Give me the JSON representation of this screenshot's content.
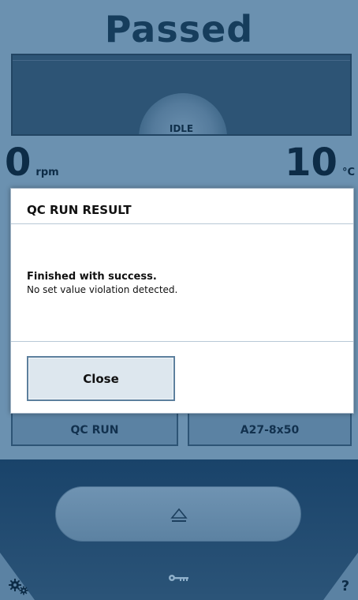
{
  "status": {
    "title": "Passed",
    "state_label": "IDLE"
  },
  "readouts": {
    "speed_value": "0",
    "speed_unit": "rpm",
    "temp_value": "10",
    "temp_unit": "°C"
  },
  "dialog": {
    "title": "QC RUN RESULT",
    "message_bold": "Finished with success.",
    "message_detail": "No set value violation detected.",
    "close_label": "Close"
  },
  "tabs": [
    {
      "label": "QC RUN"
    },
    {
      "label": "A27-8x50"
    }
  ],
  "footer": {
    "help_label": "?",
    "icons": [
      "settings-gears-icon",
      "eject-icon",
      "key-icon"
    ]
  },
  "colors": {
    "background": "#6b91b0",
    "dark_panel": "#2d5475",
    "title_text": "#163d5c",
    "dialog_bg": "#ffffff",
    "button_bg": "#dde7ee",
    "bottom_dark": "#19436a"
  }
}
